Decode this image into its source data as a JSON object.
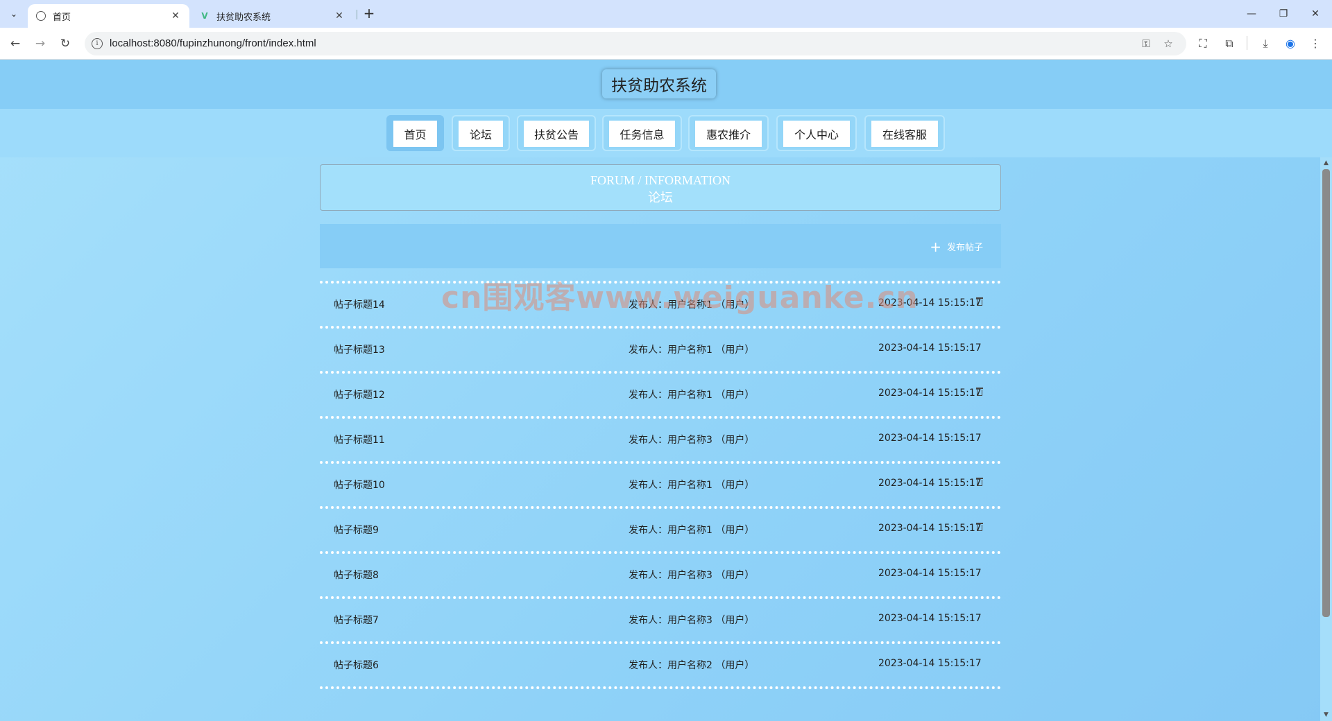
{
  "browser": {
    "tabs": [
      {
        "title": "首页",
        "active": true,
        "icon": "globe-icon"
      },
      {
        "title": "扶贫助农系统",
        "active": false,
        "icon": "vue-icon"
      }
    ],
    "url": "localhost:8080/fupinzhunong/front/index.html"
  },
  "site": {
    "title": "扶贫助农系统",
    "nav": [
      {
        "label": "首页",
        "active": true
      },
      {
        "label": "论坛",
        "active": false
      },
      {
        "label": "扶贫公告",
        "active": false
      },
      {
        "label": "任务信息",
        "active": false
      },
      {
        "label": "惠农推介",
        "active": false
      },
      {
        "label": "个人中心",
        "active": false
      },
      {
        "label": "在线客服",
        "active": false
      }
    ]
  },
  "forum": {
    "heading_en": "FORUM / INFORMATION",
    "heading_cn": "论坛",
    "post_button": "发布帖子",
    "posts": [
      {
        "title": "帖子标题14",
        "author": "发布人：用户名称1 （用户）",
        "date": "2023-04-14 15:15:17",
        "deletable": true
      },
      {
        "title": "帖子标题13",
        "author": "发布人：用户名称1 （用户）",
        "date": "2023-04-14 15:15:17",
        "deletable": false
      },
      {
        "title": "帖子标题12",
        "author": "发布人：用户名称1 （用户）",
        "date": "2023-04-14 15:15:17",
        "deletable": true
      },
      {
        "title": "帖子标题11",
        "author": "发布人：用户名称3 （用户）",
        "date": "2023-04-14 15:15:17",
        "deletable": false
      },
      {
        "title": "帖子标题10",
        "author": "发布人：用户名称1 （用户）",
        "date": "2023-04-14 15:15:17",
        "deletable": true
      },
      {
        "title": "帖子标题9",
        "author": "发布人：用户名称1 （用户）",
        "date": "2023-04-14 15:15:17",
        "deletable": true
      },
      {
        "title": "帖子标题8",
        "author": "发布人：用户名称3 （用户）",
        "date": "2023-04-14 15:15:17",
        "deletable": false
      },
      {
        "title": "帖子标题7",
        "author": "发布人：用户名称3 （用户）",
        "date": "2023-04-14 15:15:17",
        "deletable": false
      },
      {
        "title": "帖子标题6",
        "author": "发布人：用户名称2 （用户）",
        "date": "2023-04-14 15:15:17",
        "deletable": false
      }
    ]
  },
  "watermark": "cn围观客www.weiguanke.cn"
}
